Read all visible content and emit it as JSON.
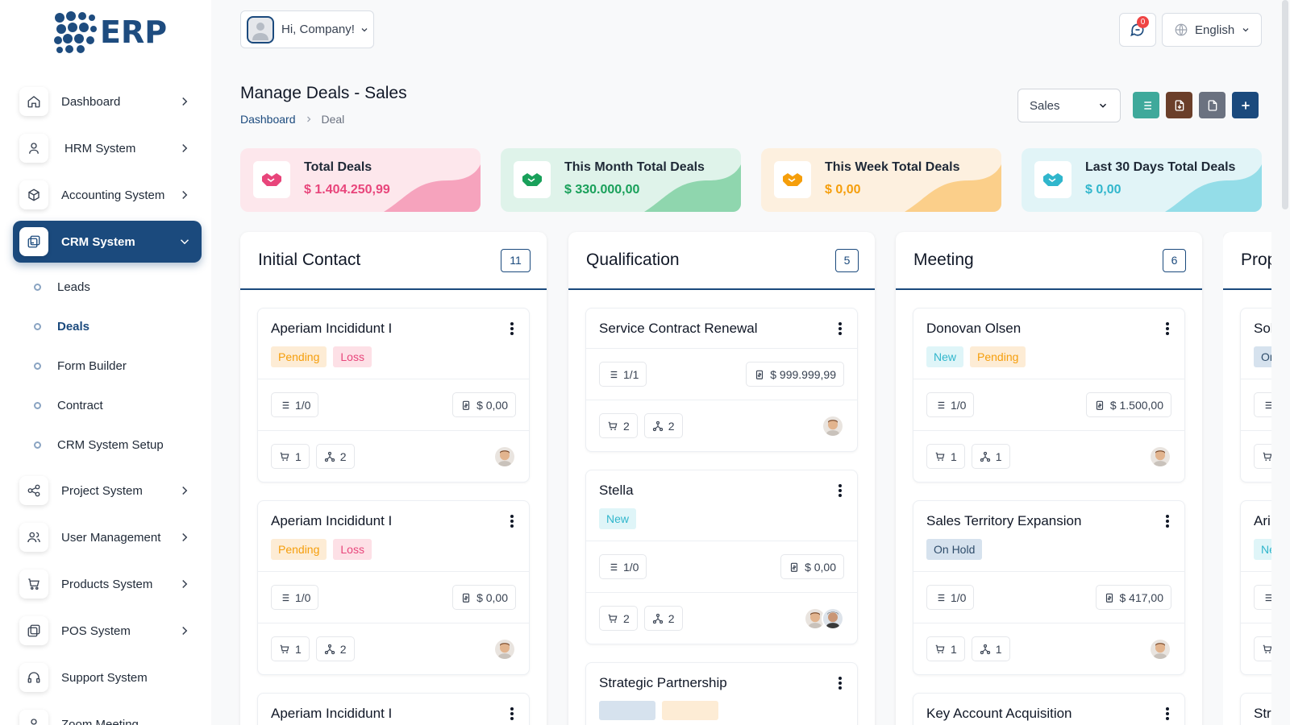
{
  "app": {
    "logo_text": "ERP"
  },
  "sidebar": {
    "items": [
      {
        "label": "Dashboard"
      },
      {
        "label": "HRM System"
      },
      {
        "label": "Accounting System"
      },
      {
        "label": "CRM System"
      },
      {
        "label": "Project System"
      },
      {
        "label": "User Management"
      },
      {
        "label": "Products System"
      },
      {
        "label": "POS System"
      },
      {
        "label": "Support System"
      },
      {
        "label": "Zoom Meeting"
      }
    ],
    "crm_sub": [
      {
        "label": "Leads"
      },
      {
        "label": "Deals"
      },
      {
        "label": "Form Builder"
      },
      {
        "label": "Contract"
      },
      {
        "label": "CRM System Setup"
      }
    ]
  },
  "header": {
    "greeting": "Hi, Company!",
    "notification_count": "0",
    "language": "English"
  },
  "page": {
    "title": "Manage Deals - Sales",
    "breadcrumb_home": "Dashboard",
    "breadcrumb_current": "Deal",
    "pipeline_select": "Sales"
  },
  "stats": [
    {
      "title": "Total Deals",
      "value": "$ 1.404.250,99",
      "color": "#e8457b"
    },
    {
      "title": "This Month Total Deals",
      "value": "$ 330.000,00",
      "color": "#19a05a"
    },
    {
      "title": "This Week Total Deals",
      "value": "$ 0,00",
      "color": "#f59e0b"
    },
    {
      "title": "Last 30 Days Total Deals",
      "value": "$ 0,00",
      "color": "#30b6cc"
    }
  ],
  "colors": {
    "primary": "#1b4a7d",
    "teal": "#3fa99b",
    "brown": "#6b3f2a",
    "gray": "#6b7280"
  },
  "board": {
    "columns": [
      {
        "title": "Initial Contact",
        "count": "11",
        "cards": [
          {
            "title": "Aperiam Incididunt I",
            "tags": [
              "Pending",
              "Loss"
            ],
            "tasks": "1/0",
            "price": "$ 0,00",
            "products": "1",
            "sources": "2"
          },
          {
            "title": "Aperiam Incididunt I",
            "tags": [
              "Pending",
              "Loss"
            ],
            "tasks": "1/0",
            "price": "$ 0,00",
            "products": "1",
            "sources": "2"
          },
          {
            "title": "Aperiam Incididunt I"
          }
        ]
      },
      {
        "title": "Qualification",
        "count": "5",
        "cards": [
          {
            "title": "Service Contract Renewal",
            "tasks": "1/1",
            "price": "$ 999.999,99",
            "products": "2",
            "sources": "2"
          },
          {
            "title": "Stella",
            "tags": [
              "New"
            ],
            "tasks": "1/0",
            "price": "$ 0,00",
            "products": "2",
            "sources": "2"
          },
          {
            "title": "Strategic Partnership"
          }
        ]
      },
      {
        "title": "Meeting",
        "count": "6",
        "cards": [
          {
            "title": "Donovan Olsen",
            "tags": [
              "New",
              "Pending"
            ],
            "tasks": "1/0",
            "price": "$ 1.500,00",
            "products": "1",
            "sources": "1"
          },
          {
            "title": "Sales Territory Expansion",
            "tags": [
              "On Hold"
            ],
            "tasks": "1/0",
            "price": "$ 417,00",
            "products": "1",
            "sources": "1"
          },
          {
            "title": "Key Account Acquisition"
          }
        ]
      },
      {
        "title": "Proposal",
        "cards": [
          {
            "title": "Sol",
            "tags": [
              "On"
            ]
          },
          {
            "title": "Ari",
            "tags": [
              "Ne"
            ]
          },
          {
            "title": "Str"
          }
        ]
      }
    ]
  }
}
